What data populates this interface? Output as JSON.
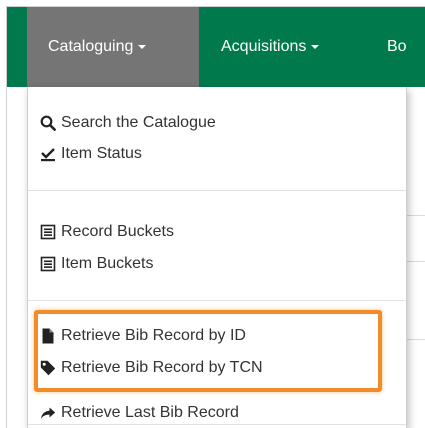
{
  "nav": {
    "items": [
      {
        "label": "Cataloguing",
        "active": true
      },
      {
        "label": "Acquisitions",
        "active": false
      },
      {
        "label": "Bo",
        "active": false
      }
    ]
  },
  "background": {
    "texts": [
      "D",
      "tr"
    ]
  },
  "menu": {
    "groups": [
      [
        {
          "label": "Search the Catalogue",
          "icon": "search-icon"
        },
        {
          "label": "Item Status",
          "icon": "checkmark-underline-icon"
        }
      ],
      [
        {
          "label": "Record Buckets",
          "icon": "list-alt-icon"
        },
        {
          "label": "Item Buckets",
          "icon": "list-alt-icon"
        }
      ],
      [
        {
          "label": "Retrieve Bib Record by ID",
          "icon": "file-icon"
        },
        {
          "label": "Retrieve Bib Record by TCN",
          "icon": "tag-icon"
        },
        {
          "label": "Retrieve Last Bib Record",
          "icon": "share-arrow-icon"
        }
      ]
    ]
  },
  "colors": {
    "navbar": "#007a4d",
    "active_tab": "#757575",
    "highlight": "#f28c28"
  }
}
